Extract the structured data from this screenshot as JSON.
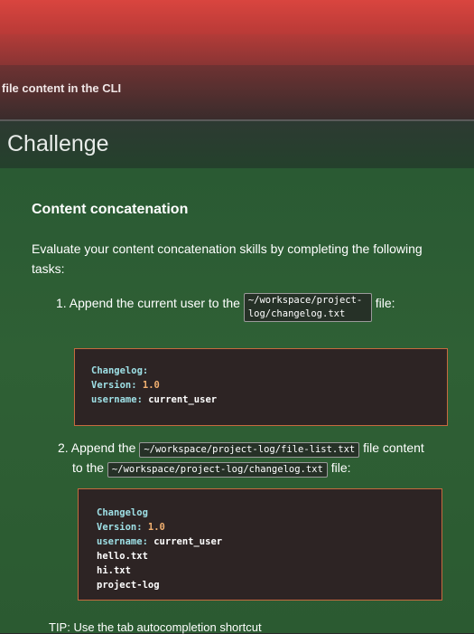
{
  "header": {
    "lesson_title": "file content in the CLI"
  },
  "challenge": {
    "title": "Challenge"
  },
  "section": {
    "title": "Content concatenation",
    "intro": "Evaluate your content concatenation skills by completing the following tasks:"
  },
  "task1": {
    "prefix": "1. Append the current user to the",
    "path": "~/workspace/project-log/changelog.txt",
    "suffix": "file:",
    "code": {
      "line1_label": "Changelog:",
      "line2_label": "Version:",
      "line2_value": "1.0",
      "line3_label": "username:",
      "line3_value": "current_user"
    }
  },
  "task2": {
    "prefix": "2. Append the",
    "path1": "~/workspace/project-log/file-list.txt",
    "mid": "file content",
    "to_the": "to the",
    "path2": "~/workspace/project-log/changelog.txt",
    "suffix": "file:",
    "code": {
      "line1": "Changelog",
      "line2_label": "Version:",
      "line2_value": "1.0",
      "line3_label": "username:",
      "line3_value": "current_user",
      "line4": "hello.txt",
      "line5": "hi.txt",
      "line6": "project-log"
    }
  },
  "tip": {
    "text": "TIP: Use the tab autocompletion shortcut"
  },
  "colors": {
    "topbar": "#d9453f",
    "content_bg": "#2f6035",
    "codebox_border": "#c66a3f",
    "code_label": "#9ee0e6",
    "code_value": "#f2b070"
  }
}
